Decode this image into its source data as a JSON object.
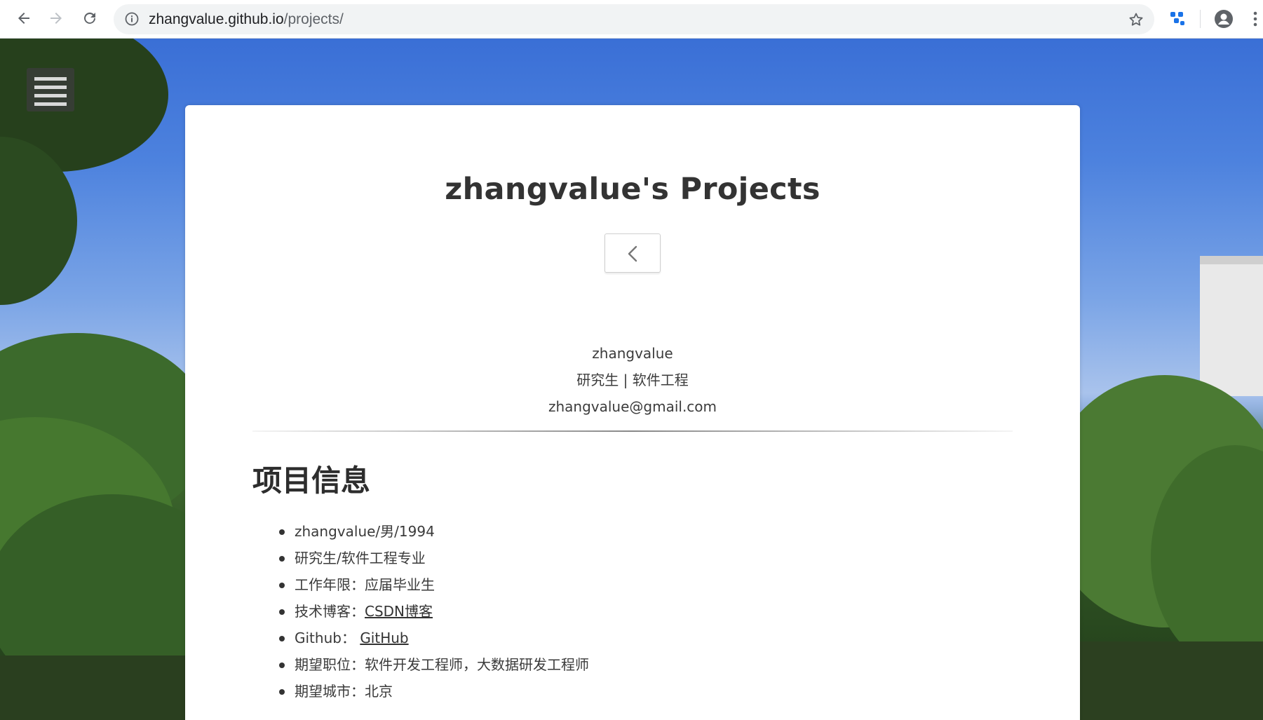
{
  "browser": {
    "url_host": "zhangvalue.github.io",
    "url_path": "/projects/"
  },
  "header": {
    "title": "zhangvalue's Projects"
  },
  "profile": {
    "name": "zhangvalue",
    "role": "研究生 | 软件工程",
    "email": "zhangvalue@gmail.com"
  },
  "section": {
    "heading": "项目信息"
  },
  "info": {
    "items": [
      {
        "label": "zhangvalue/男/1994"
      },
      {
        "label": "研究生/软件工程专业"
      },
      {
        "label": "工作年限：应届毕业生"
      },
      {
        "label": "技术博客：",
        "link": "CSDN博客"
      },
      {
        "label": "Github：",
        "link": "GitHub"
      },
      {
        "label": "期望职位：软件开发工程师，大数据研发工程师"
      },
      {
        "label": "期望城市：北京"
      }
    ]
  },
  "colors": {
    "accent_link": "#333333",
    "title_text": "#333333"
  }
}
